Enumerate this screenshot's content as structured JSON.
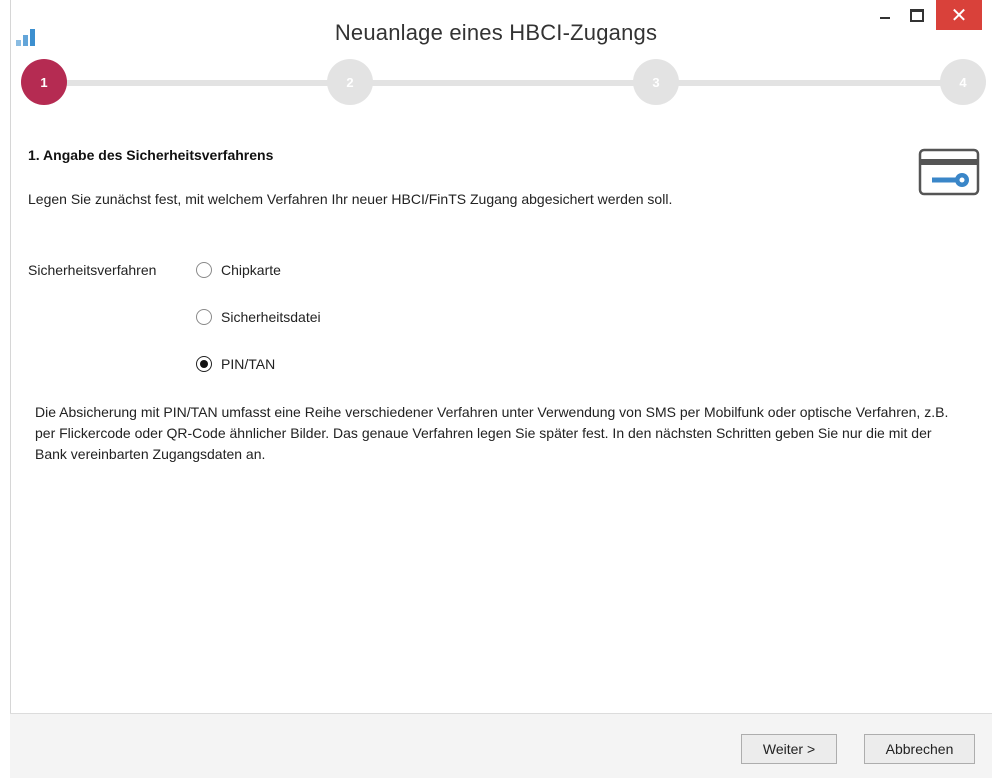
{
  "window": {
    "title": "Neuanlage eines HBCI-Zugangs"
  },
  "stepper": {
    "steps": [
      {
        "label": "1",
        "active": true
      },
      {
        "label": "2",
        "active": false
      },
      {
        "label": "3",
        "active": false
      },
      {
        "label": "4",
        "active": false
      }
    ],
    "active_color": "#b52b52",
    "inactive_color": "#e3e3e3"
  },
  "section": {
    "heading": "1. Angabe des Sicherheitsverfahrens",
    "intro": "Legen Sie zunächst fest, mit welchem Verfahren Ihr neuer HBCI/FinTS Zugang abgesichert werden soll.",
    "icon": "card-key-icon"
  },
  "security_method": {
    "label": "Sicherheitsverfahren",
    "options": [
      {
        "label": "Chipkarte",
        "checked": false
      },
      {
        "label": "Sicherheitsdatei",
        "checked": false
      },
      {
        "label": "PIN/TAN",
        "checked": true
      }
    ],
    "description": "Die Absicherung mit PIN/TAN umfasst eine Reihe verschiedener Verfahren unter Verwendung von SMS per Mobilfunk oder optische Verfahren, z.B. per Flickercode oder QR-Code ähnlicher Bilder. Das genaue Verfahren legen Sie später fest. In den nächsten Schritten geben Sie nur die mit der Bank vereinbarten Zugangsdaten an."
  },
  "footer": {
    "next_label": "Weiter >",
    "cancel_label": "Abbrechen"
  },
  "colors": {
    "close_button": "#d9413a",
    "app_icon": "#3c8fcf",
    "card_icon": "#3a86c8"
  }
}
